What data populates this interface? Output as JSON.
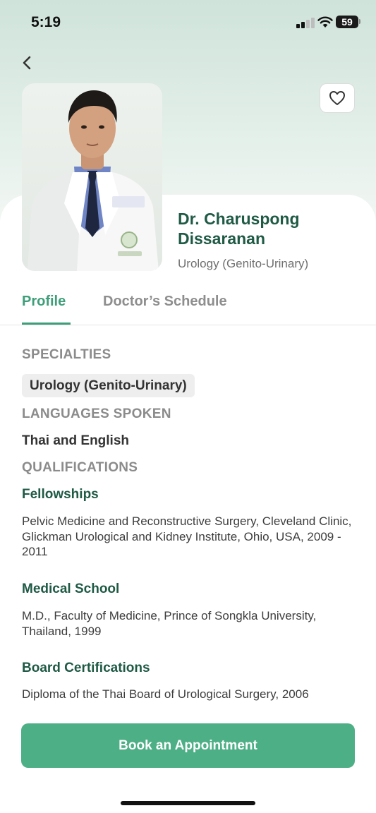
{
  "status_bar": {
    "time": "5:19",
    "battery": "59"
  },
  "header": {
    "back_icon": "chevron-left-icon",
    "favorite_icon": "heart-outline-icon"
  },
  "doctor": {
    "name": "Dr. Charuspong Dissaranan",
    "department": "Urology (Genito-Urinary)"
  },
  "tabs": [
    {
      "label": "Profile",
      "active": true
    },
    {
      "label": "Doctor’s Schedule",
      "active": false
    }
  ],
  "profile": {
    "specialties_heading": "SPECIALTIES",
    "specialties": [
      "Urology (Genito-Urinary)"
    ],
    "languages_heading": "LANGUAGES SPOKEN",
    "languages": "Thai and English",
    "qualifications_heading": "QUALIFICATIONS",
    "qualifications": [
      {
        "title": "Fellowships",
        "text": "Pelvic Medicine and Reconstructive Surgery, Cleveland Clinic, Glickman Urological and Kidney Institute, Ohio, USA, 2009 - 2011"
      },
      {
        "title": "Medical School",
        "text": "M.D., Faculty of Medicine, Prince of Songkla University, Thailand, 1999"
      },
      {
        "title": "Board Certifications",
        "text": "Diploma of the Thai Board of Urological Surgery, 2006"
      }
    ]
  },
  "actions": {
    "book_label": "Book an Appointment"
  },
  "colors": {
    "accent": "#4daf85",
    "tab_active": "#3e9e7a",
    "heading_green": "#1f5a45"
  }
}
